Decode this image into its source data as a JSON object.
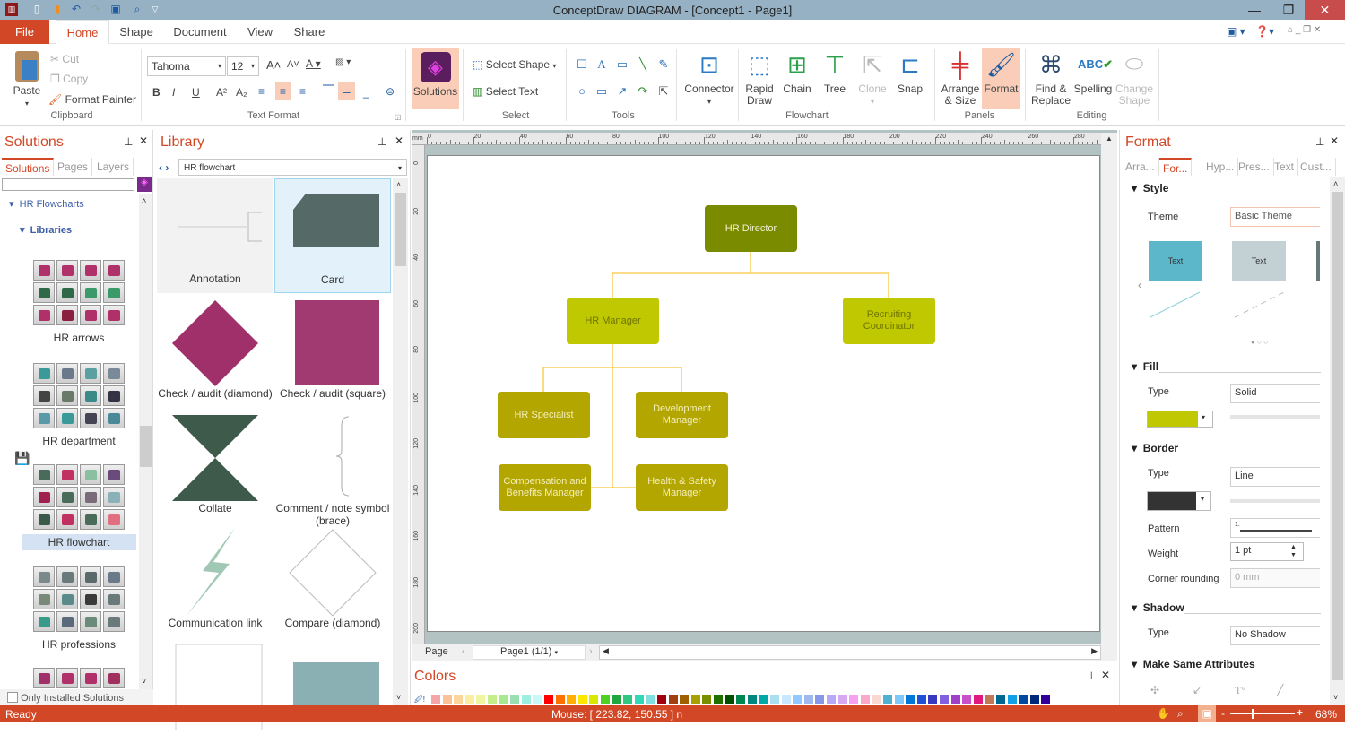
{
  "window": {
    "title": "ConceptDraw DIAGRAM - [Concept1 - Page1]",
    "minimize": "—",
    "restore": "❐",
    "close": "✕"
  },
  "ribbon_tabs": {
    "file": "File",
    "home": "Home",
    "shape": "Shape",
    "document": "Document",
    "view": "View",
    "share": "Share"
  },
  "clipboard": {
    "paste": "Paste",
    "cut": "Cut",
    "copy": "Copy",
    "format_painter": "Format Painter",
    "label": "Clipboard"
  },
  "text_format": {
    "font": "Tahoma",
    "size": "12",
    "label": "Text Format"
  },
  "solutions_btn": "Solutions",
  "select": {
    "select_shape": "Select Shape",
    "select_text": "Select Text",
    "label": "Select"
  },
  "tools": {
    "label": "Tools"
  },
  "flowchart": {
    "connector": "Connector",
    "rapid_draw": "Rapid Draw",
    "chain": "Chain",
    "tree": "Tree",
    "clone": "Clone",
    "snap": "Snap",
    "label": "Flowchart"
  },
  "panels": {
    "arrange": "Arrange & Size",
    "format": "Format",
    "label": "Panels"
  },
  "editing": {
    "find": "Find & Replace",
    "spelling": "Spelling",
    "change_shape": "Change Shape",
    "label": "Editing"
  },
  "solutions_panel": {
    "title": "Solutions",
    "tabs": [
      "Solutions",
      "Pages",
      "Layers"
    ],
    "search_value": "",
    "tree_root": "HR Flowcharts",
    "tree_child": "Libraries",
    "libraries": [
      {
        "name": "HR arrows"
      },
      {
        "name": "HR department"
      },
      {
        "name": "HR flowchart",
        "selected": true
      },
      {
        "name": "HR professions"
      },
      {
        "name": ""
      }
    ],
    "only_installed": "Only Installed Solutions"
  },
  "library_panel": {
    "title": "Library",
    "selected": "HR flowchart",
    "items": [
      "Annotation",
      "Card",
      "Check / audit (diamond)",
      "Check / audit (square)",
      "Collate",
      "Comment / note symbol (brace)",
      "Communication link",
      "Compare (diamond)"
    ]
  },
  "ruler": {
    "unit": "mm",
    "ticks": [
      "0",
      "20",
      "40",
      "60",
      "80",
      "100",
      "120",
      "140",
      "160",
      "180",
      "200",
      "220",
      "240",
      "260",
      "280"
    ],
    "vticks": [
      "0",
      "20",
      "40",
      "60",
      "80",
      "100",
      "120",
      "140",
      "160",
      "180",
      "200"
    ]
  },
  "diagram": {
    "nodes": [
      {
        "id": "director",
        "label": "HR Director",
        "fill": "#7b8b00",
        "text": "#f2f2d0"
      },
      {
        "id": "manager",
        "label": "HR Manager",
        "fill": "#bfc800",
        "text": "#6f7400"
      },
      {
        "id": "recruiting",
        "label": "Recruiting Coordinator",
        "fill": "#bfc800",
        "text": "#6f7400"
      },
      {
        "id": "specialist",
        "label": "HR Specialist",
        "fill": "#b3a600",
        "text": "#f4eeb8"
      },
      {
        "id": "development",
        "label": "Development Manager",
        "fill": "#b3a600",
        "text": "#f4eeb8"
      },
      {
        "id": "compensation",
        "label": "Compensation and Benefits Manager",
        "fill": "#b3a600",
        "text": "#f4eeb8"
      },
      {
        "id": "safety",
        "label": "Health & Safety Manager",
        "fill": "#b3a600",
        "text": "#f4eeb8"
      }
    ],
    "connector_color": "#fbc540"
  },
  "page_nav": {
    "label": "Page",
    "current": "Page1 (1/1)"
  },
  "colors_panel": {
    "title": "Colors",
    "palette": [
      "#f4a6a6",
      "#f9c39a",
      "#fbd59a",
      "#fbeea0",
      "#f0f5a0",
      "#c5ee88",
      "#a8e890",
      "#98e0b0",
      "#9cf0e0",
      "#c8f8f8",
      "#ff0000",
      "#ff7000",
      "#ffb000",
      "#ffe800",
      "#d8e800",
      "#50d020",
      "#20a840",
      "#30c880",
      "#30d8b8",
      "#80e0e0",
      "#a00010",
      "#a04010",
      "#a06000",
      "#a8a000",
      "#789000",
      "#207000",
      "#005000",
      "#008850",
      "#008880",
      "#00a8a8",
      "#a8e0f0",
      "#c8e8ff",
      "#90c8ff",
      "#a0b8f0",
      "#8898e8",
      "#b8a8f8",
      "#d8a8f0",
      "#f8a0f0",
      "#f8a8c8",
      "#f8d8d0",
      "#50b0d0",
      "#80c8f8",
      "#0078d8",
      "#2050d8",
      "#3838c0",
      "#8060e0",
      "#a040c8",
      "#c850c8",
      "#e01880",
      "#c07858",
      "#006890",
      "#10a0e8",
      "#0048a0",
      "#002878",
      "#300098"
    ]
  },
  "format_panel": {
    "title": "Format",
    "tabs": [
      "Arra...",
      "For...",
      "Hyp...",
      "Pres...",
      "Text",
      "Cust..."
    ],
    "style": {
      "header": "Style",
      "theme_label": "Theme",
      "theme": "Basic Theme",
      "preview_text": "Text"
    },
    "fill": {
      "header": "Fill",
      "type_label": "Type",
      "type": "Solid",
      "color": "#bfc800"
    },
    "border": {
      "header": "Border",
      "type_label": "Type",
      "type": "Line",
      "color": "#333333",
      "pattern_label": "Pattern",
      "pattern_prefix": "1:",
      "weight_label": "Weight",
      "weight": "1 pt",
      "corner_label": "Corner rounding",
      "corner": "0 mm"
    },
    "shadow": {
      "header": "Shadow",
      "type_label": "Type",
      "type": "No Shadow"
    },
    "same": {
      "header": "Make Same Attributes"
    }
  },
  "status": {
    "left": "Ready",
    "mouse": "Mouse: [ 223.82, 150.55 ] n",
    "zoom": "68%",
    "zoom_level": 0.68
  },
  "accent": "#d24726"
}
